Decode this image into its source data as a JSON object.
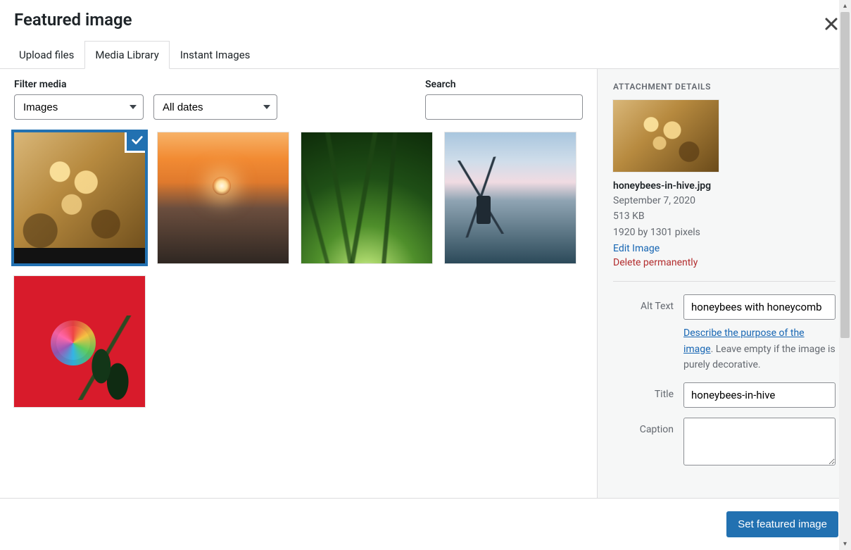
{
  "header": {
    "title": "Featured image"
  },
  "tabs": {
    "upload": "Upload files",
    "library": "Media Library",
    "instant": "Instant Images"
  },
  "filters": {
    "label": "Filter media",
    "type_value": "Images",
    "date_value": "All dates"
  },
  "search": {
    "label": "Search",
    "value": ""
  },
  "details": {
    "heading": "ATTACHMENT DETAILS",
    "filename": "honeybees-in-hive.jpg",
    "date": "September 7, 2020",
    "size": "513 KB",
    "dimensions": "1920 by 1301 pixels",
    "edit_link": "Edit Image",
    "delete_link": "Delete permanently",
    "fields": {
      "alt_label": "Alt Text",
      "alt_value": "honeybees with honeycomb",
      "alt_help_link": "Describe the purpose of the image",
      "alt_help_rest": ". Leave empty if the image is purely decorative.",
      "title_label": "Title",
      "title_value": "honeybees-in-hive",
      "caption_label": "Caption",
      "caption_value": ""
    }
  },
  "footer": {
    "submit": "Set featured image"
  }
}
